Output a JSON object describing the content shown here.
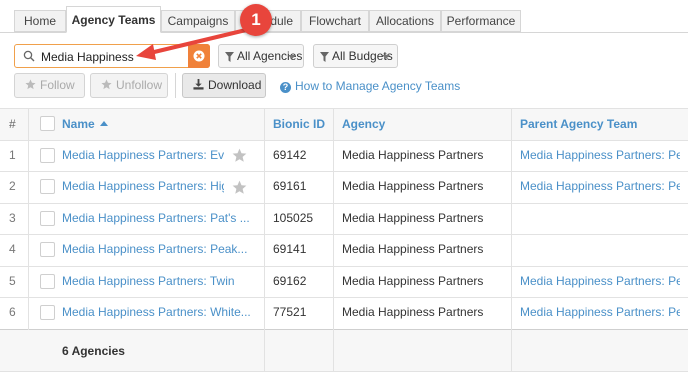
{
  "tabs": [
    {
      "label": "Home"
    },
    {
      "label": "Agency Teams"
    },
    {
      "label": "Campaigns"
    },
    {
      "label": "Schedule"
    },
    {
      "label": "Flowchart"
    },
    {
      "label": "Allocations"
    },
    {
      "label": "Performance"
    }
  ],
  "search": {
    "value": "Media Happiness"
  },
  "filters": {
    "agencies": "All Agencies",
    "budgets": "All Budgets"
  },
  "actions": {
    "follow": "Follow",
    "unfollow": "Unfollow",
    "download": "Download",
    "help": "How to Manage Agency Teams"
  },
  "annotation": {
    "number": "1"
  },
  "table": {
    "columns": {
      "index": "#",
      "name": "Name",
      "bionic_id": "Bionic ID",
      "agency": "Agency",
      "parent": "Parent Agency Team"
    },
    "rows": [
      {
        "index": "1",
        "name": "Media Happiness Partners: Everest",
        "bionic_id": "69142",
        "agency": "Media Happiness Partners",
        "parent": "Media Happiness Partners: Peak...",
        "starred": true
      },
      {
        "index": "2",
        "name": "Media Happiness Partners: Highest",
        "bionic_id": "69161",
        "agency": "Media Happiness Partners",
        "parent": "Media Happiness Partners: Peak...",
        "starred": true
      },
      {
        "index": "3",
        "name": "Media Happiness Partners: Pat's ...",
        "bionic_id": "105025",
        "agency": "Media Happiness Partners",
        "parent": "",
        "starred": false
      },
      {
        "index": "4",
        "name": "Media Happiness Partners: Peak...",
        "bionic_id": "69141",
        "agency": "Media Happiness Partners",
        "parent": "",
        "starred": false
      },
      {
        "index": "5",
        "name": "Media Happiness Partners: Twin",
        "bionic_id": "69162",
        "agency": "Media Happiness Partners",
        "parent": "Media Happiness Partners: Peak...",
        "starred": false
      },
      {
        "index": "6",
        "name": "Media Happiness Partners: White...",
        "bionic_id": "77521",
        "agency": "Media Happiness Partners",
        "parent": "Media Happiness Partners: Peak...",
        "starred": false
      }
    ],
    "footer": "6 Agencies"
  },
  "colors": {
    "accent": "#4a90c8",
    "search_border": "#f0a04b",
    "clear": "#f0813a",
    "annotation": "#e8453c"
  }
}
